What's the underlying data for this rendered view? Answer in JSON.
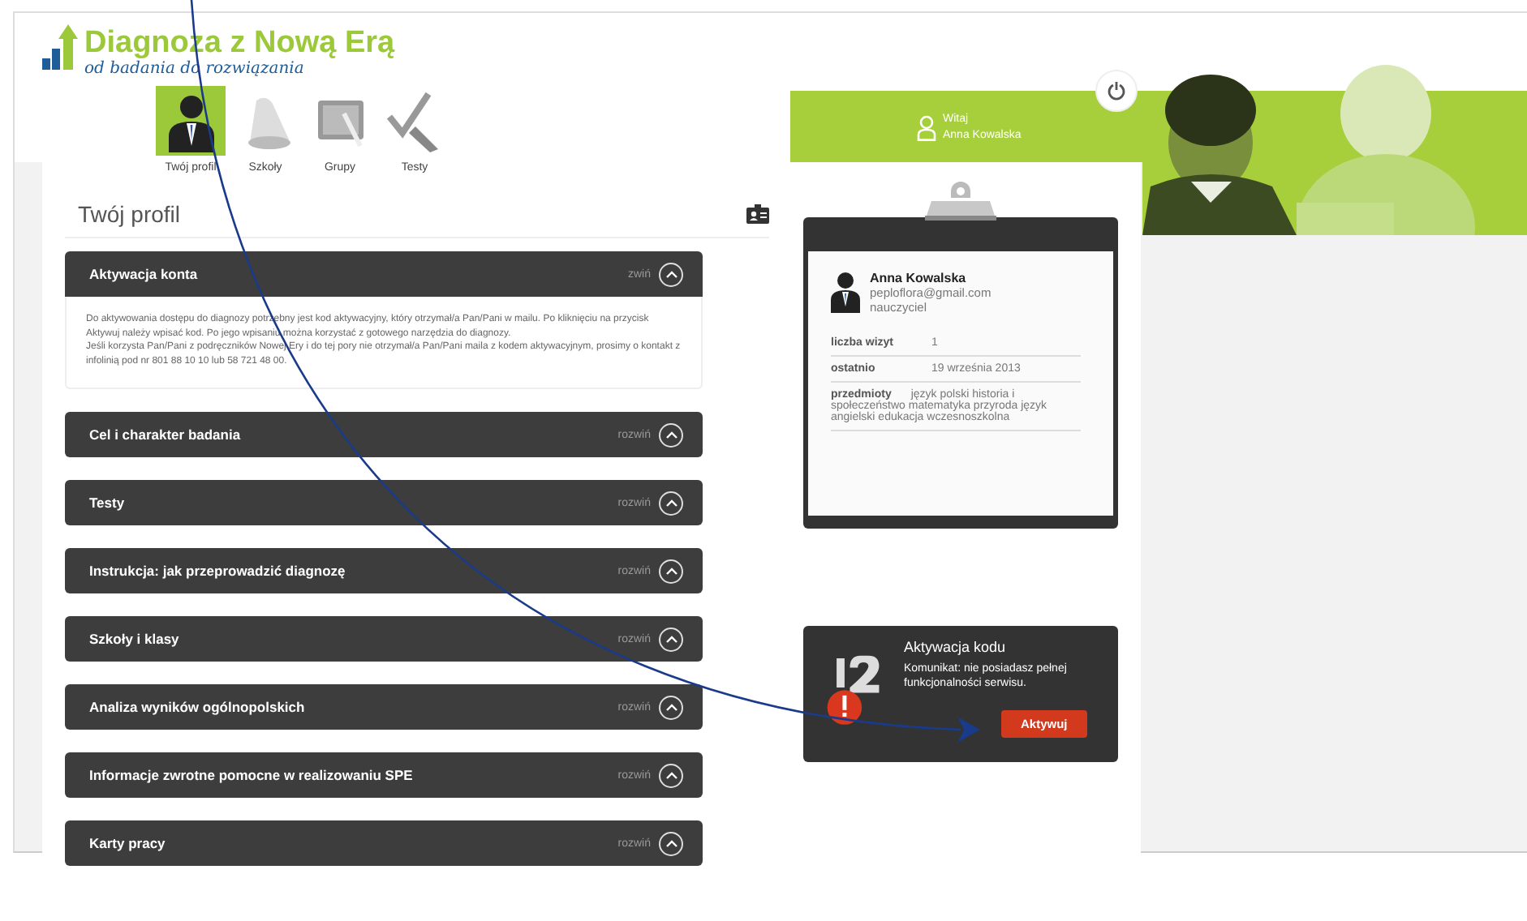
{
  "logo": {
    "title": "Diagnoza z Nową Erą",
    "tagline": "od badania do rozwiązania"
  },
  "nav": [
    {
      "label": "Twój profil",
      "kind": "profile",
      "selected": true
    },
    {
      "label": "Szkoły",
      "kind": "bell",
      "selected": false
    },
    {
      "label": "Grupy",
      "kind": "board",
      "selected": false
    },
    {
      "label": "Testy",
      "kind": "check",
      "selected": false
    }
  ],
  "user": {
    "greeting": "Witaj",
    "name": "Anna Kowalska"
  },
  "page_title": "Twój profil",
  "sections": [
    {
      "title": "Aktywacja konta",
      "action": "zwiń",
      "expanded": true,
      "body": [
        "Do aktywowania dostępu do diagnozy potrzebny jest kod aktywacyjny, który otrzymał/a Pan/Pani w mailu. Po kliknięciu na przycisk Aktywuj należy wpisać kod. Po jego wpisaniu można korzystać z gotowego narzędzia do diagnozy.",
        "Jeśli korzysta Pan/Pani z podręczników Nowej Ery i do tej pory nie otrzymał/a Pan/Pani maila z kodem aktywacyjnym, prosimy o kontakt z infolinią pod nr 801 88 10 10 lub 58 721 48 00."
      ]
    },
    {
      "title": "Cel i charakter badania",
      "action": "rozwiń",
      "expanded": false
    },
    {
      "title": "Testy",
      "action": "rozwiń",
      "expanded": false
    },
    {
      "title": "Instrukcja: jak przeprowadzić diagnozę",
      "action": "rozwiń",
      "expanded": false
    },
    {
      "title": "Szkoły i klasy",
      "action": "rozwiń",
      "expanded": false
    },
    {
      "title": "Analiza wyników ogólnopolskich",
      "action": "rozwiń",
      "expanded": false
    },
    {
      "title": "Informacje zwrotne pomocne w realizowaniu SPE",
      "action": "rozwiń",
      "expanded": false
    },
    {
      "title": "Karty pracy",
      "action": "rozwiń",
      "expanded": false
    }
  ],
  "profile": {
    "name": "Anna Kowalska",
    "email": "peploflora@gmail.com",
    "role": "nauczyciel",
    "details": [
      {
        "label": "liczba wizyt",
        "value": "1"
      },
      {
        "label": "ostatnio",
        "value": "19 września 2013"
      },
      {
        "label": "przedmioty",
        "value": "język polski historia i społeczeństwo matematyka przyroda język angielski edukacja wczesnoszkolna"
      }
    ]
  },
  "activation": {
    "title": "Aktywacja kodu",
    "message": "Komunikat: nie posiadasz pełnej funkcjonalności serwisu.",
    "button": "Aktywuj"
  }
}
